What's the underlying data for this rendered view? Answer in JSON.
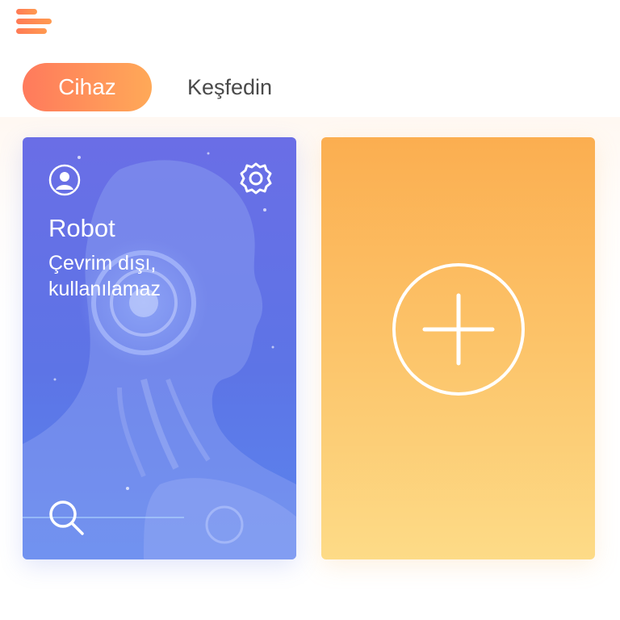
{
  "header": {
    "menu_icon": "hamburger-menu-icon"
  },
  "tabs": [
    {
      "label": "Cihaz",
      "active": true
    },
    {
      "label": "Keşfedin",
      "active": false
    }
  ],
  "devices": [
    {
      "name": "Robot",
      "status": "Çevrim dışı, kullanılamaz",
      "icons": [
        "user-icon",
        "gear-icon",
        "search-icon"
      ]
    }
  ],
  "add_card": {
    "icon": "plus-circle-icon"
  },
  "colors": {
    "accent_start": "#ff7a5c",
    "accent_end": "#ffa958",
    "robot_card": "#6a6ee6",
    "add_card_top": "#fbae50",
    "add_card_bottom": "#fddb87"
  }
}
